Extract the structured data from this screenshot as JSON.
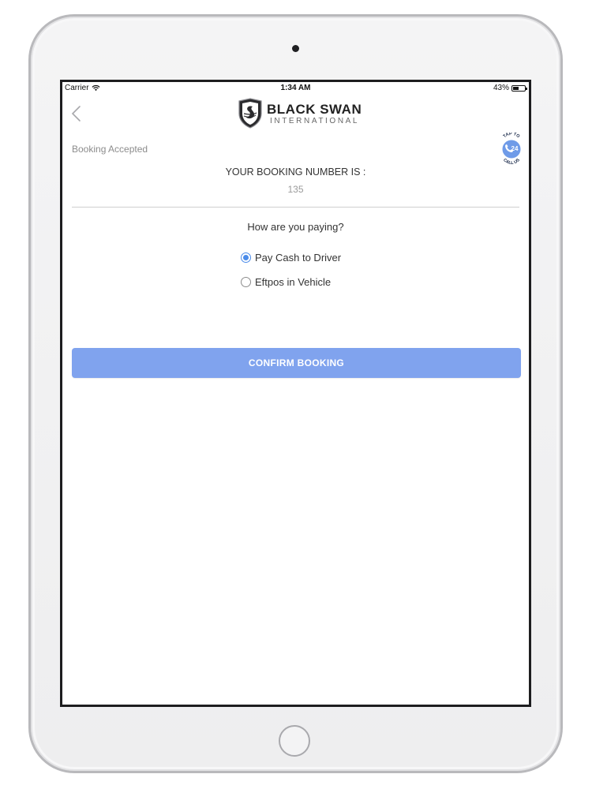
{
  "status_bar": {
    "carrier": "Carrier",
    "time": "1:34 AM",
    "battery": "43%"
  },
  "header": {
    "brand_main": "BLACK SWAN",
    "brand_sub": "INTERNATIONAL"
  },
  "call_badge": {
    "top_text": "TAP TO",
    "number": "24",
    "bottom_text": "CALL US"
  },
  "booking": {
    "status": "Booking Accepted",
    "number_label": "YOUR BOOKING NUMBER IS :",
    "number_value": "135"
  },
  "payment": {
    "question": "How are you paying?",
    "options": [
      {
        "label": "Pay Cash to Driver",
        "selected": true
      },
      {
        "label": "Eftpos in Vehicle",
        "selected": false
      }
    ]
  },
  "confirm_button": {
    "label": "CONFIRM BOOKING"
  },
  "colors": {
    "accent": "#4a8bea",
    "button": "#80a3ee"
  },
  "icons": [
    "wifi-icon",
    "battery-icon",
    "back-chevron-icon",
    "swan-shield-logo-icon",
    "phone-icon"
  ]
}
